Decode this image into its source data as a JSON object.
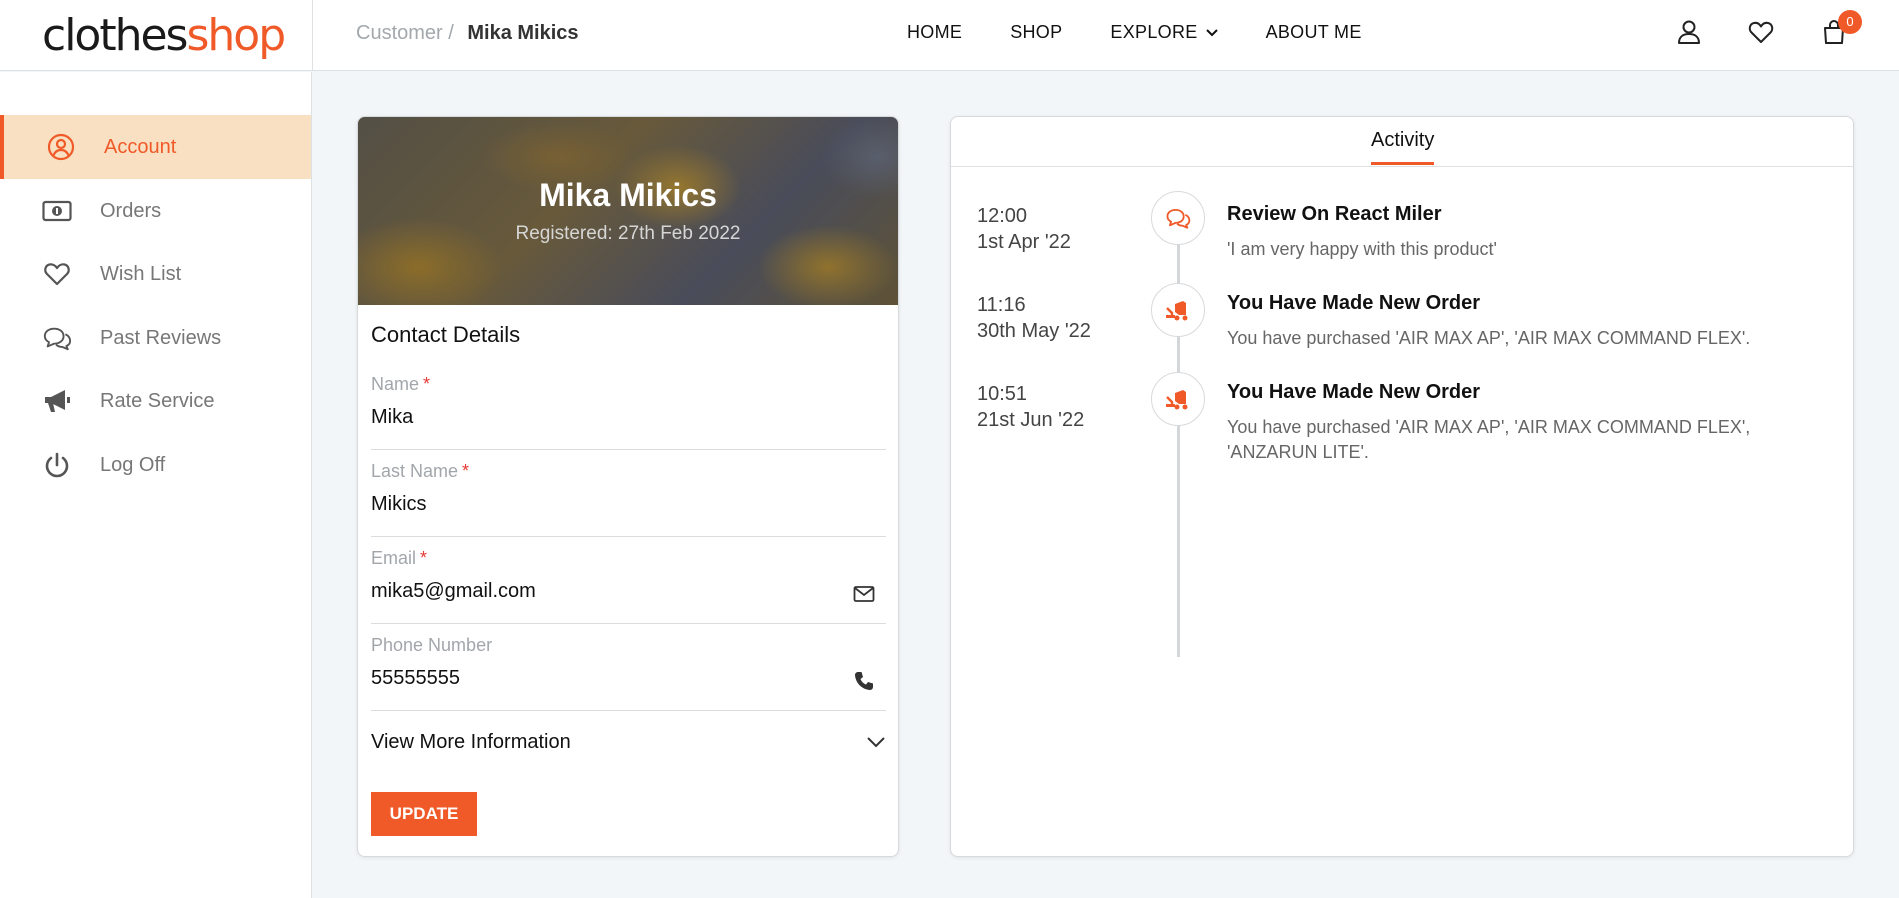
{
  "header": {
    "logo_part1": "clothes",
    "logo_part2": "shop",
    "breadcrumb_parent": "Customer /",
    "breadcrumb_current": "Mika Mikics",
    "nav": [
      "HOME",
      "SHOP",
      "EXPLORE",
      "ABOUT ME"
    ],
    "cart_count": "0",
    "accent_color": "#f05a28"
  },
  "sidebar": {
    "items": [
      {
        "label": "Account",
        "icon": "user-circle-icon",
        "active": true
      },
      {
        "label": "Orders",
        "icon": "money-icon",
        "active": false
      },
      {
        "label": "Wish List",
        "icon": "heart-icon",
        "active": false
      },
      {
        "label": "Past Reviews",
        "icon": "comments-icon",
        "active": false
      },
      {
        "label": "Rate Service",
        "icon": "megaphone-icon",
        "active": false
      },
      {
        "label": "Log Off",
        "icon": "power-icon",
        "active": false
      }
    ]
  },
  "profile": {
    "name": "Mika Mikics",
    "registered": "Registered: 27th Feb 2022",
    "section_title": "Contact Details",
    "fields": {
      "name": {
        "label": "Name",
        "required": "*",
        "value": "Mika"
      },
      "last_name": {
        "label": "Last Name",
        "required": "*",
        "value": "Mikics"
      },
      "email": {
        "label": "Email",
        "required": "*",
        "value": "mika5@gmail.com"
      },
      "phone": {
        "label": "Phone Number",
        "value": "55555555"
      }
    },
    "more_info_label": "View More Information",
    "update_label": "UPDATE"
  },
  "activity": {
    "tab_label": "Activity",
    "items": [
      {
        "time": "12:00",
        "date": "1st Apr '22",
        "icon": "comments-icon",
        "title": "Review On React Miler",
        "desc": "'I am very happy with this product'"
      },
      {
        "time": "11:16",
        "date": "30th May '22",
        "icon": "delivery-icon",
        "title": "You Have Made New Order",
        "desc": "You have purchased 'AIR MAX AP', 'AIR MAX COMMAND FLEX'."
      },
      {
        "time": "10:51",
        "date": "21st Jun '22",
        "icon": "delivery-icon",
        "title": "You Have Made New Order",
        "desc": "You have purchased 'AIR MAX AP', 'AIR MAX COMMAND FLEX', 'ANZARUN LITE'."
      }
    ]
  }
}
